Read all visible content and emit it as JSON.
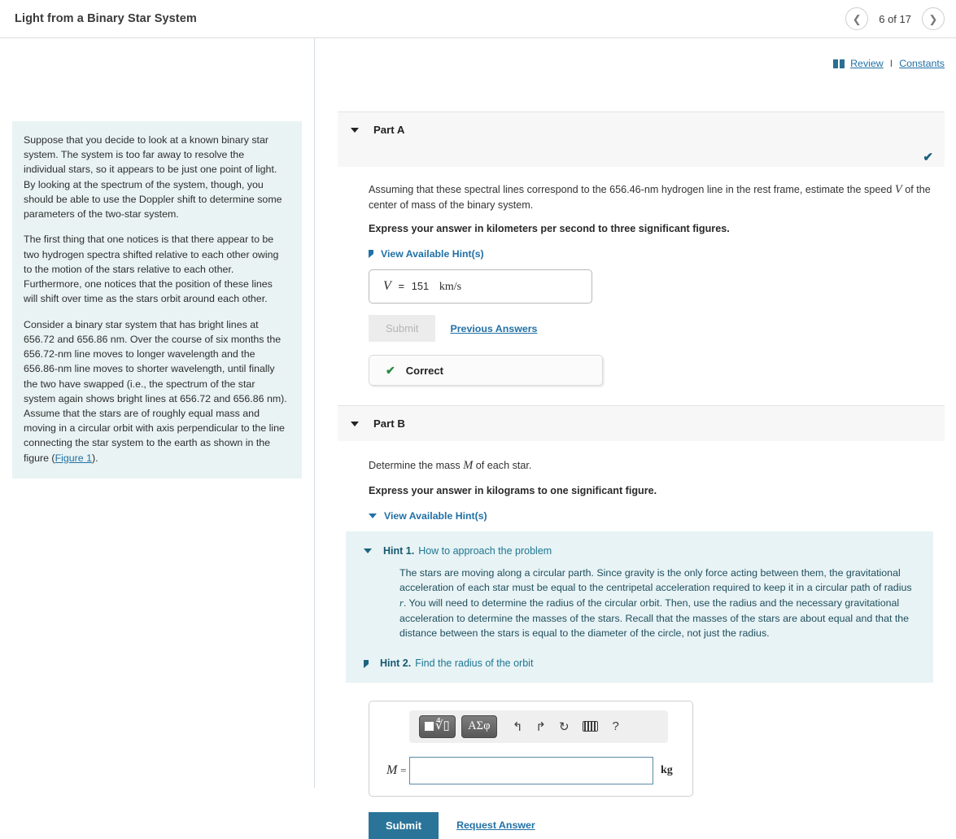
{
  "topbar": {
    "title": "Light from a Binary Star System",
    "prev_icon": "chevron-left-icon",
    "next_icon": "chevron-right-icon",
    "page_label": "6 of 17"
  },
  "tools": {
    "book_icon": "book-icon",
    "review": "Review",
    "separator": "I",
    "constants": "Constants"
  },
  "statement": {
    "paragraphs": [
      "Suppose that you decide to look at a known binary star system. The system is too far away to resolve the individual stars, so it appears to be just one point of light. By looking at the spectrum of the system, though, you should be able to use the Doppler shift to determine some parameters of the two-star system.",
      "The first thing that one notices is that there appear to be two hydrogen spectra shifted relative to each other owing to the motion of the stars relative to each other. Furthermore, one notices that the position of these lines will shift over time as the stars orbit around each other."
    ],
    "final_paragraph_before_link": "Consider a binary star system that has bright lines at 656.72 and 656.86 nm. Over the course of six months the 656.72-nm line moves to longer wavelength and the 656.86-nm line moves to shorter wavelength, until finally the two have swapped (i.e., the spectrum of the star system again shows bright lines at 656.72 and 656.86 nm). Assume that the stars are of roughly equal mass and moving in a circular orbit with axis perpendicular to the line connecting the star system to the earth as shown in the figure (",
    "figure_link": "Figure 1",
    "final_paragraph_after_link": ")."
  },
  "part_a": {
    "title": "Part A",
    "caret_icon": "caret-down-icon",
    "status_icon": "check-icon",
    "question_before_var": "Assuming that these spectral lines correspond to the 656.46-nm hydrogen line in the rest frame, estimate the speed ",
    "question_var": "V",
    "question_after_var": " of the center of mass of the binary system.",
    "instruction": "Express your answer in kilometers per second to three significant figures.",
    "hints_toggle": "View Available Hint(s)",
    "hints_toggle_icon": "caret-right-icon",
    "answer_var": "V",
    "answer_equals": "=",
    "answer_value": "151",
    "answer_unit": "km/s",
    "submit_label": "Submit",
    "previous_answers_label": "Previous Answers",
    "result_icon": "check-icon",
    "result_label": "Correct"
  },
  "part_b": {
    "title": "Part B",
    "caret_icon": "caret-down-icon",
    "question_before_var": "Determine the mass ",
    "question_var": "M",
    "question_after_var": " of each star.",
    "instruction": "Express your answer in kilograms to one significant figure.",
    "hints_toggle": "View Available Hint(s)",
    "hints_toggle_icon": "caret-down-icon",
    "hints": [
      {
        "caret_icon": "caret-down-icon",
        "number": "Hint 1.",
        "name": "How to approach the problem",
        "body_part1": "The stars are moving along a circular parth. Since gravity is the only force acting between them, the gravitational acceleration of each star must be equal to the centripetal acceleration required to keep it in a circular path of radius ",
        "body_var": "r",
        "body_part2": ". You will need to determine the radius of the circular orbit. Then, use the radius and the necessary gravitational acceleration to determine the masses of the stars. Recall that the masses of the stars are about equal and that the distance between the stars is equal to the diameter of the circle, not just the radius."
      },
      {
        "caret_icon": "caret-right-icon",
        "number": "Hint 2.",
        "name": "Find the radius of the orbit"
      }
    ],
    "toolbar": {
      "template_button": "template-button",
      "template_square": "square-glyph",
      "template_root": "∜▯",
      "greek_button": "ΑΣφ",
      "undo_icon": "undo-arrow-icon",
      "undo_glyph": "↰",
      "redo_icon": "redo-arrow-icon",
      "redo_glyph": "↱",
      "reset_icon": "reset-circle-icon",
      "reset_glyph": "↻",
      "keyboard_icon": "keyboard-icon",
      "help_icon": "question-mark-icon",
      "help_glyph": "?"
    },
    "entry_var": "M",
    "entry_equals": "=",
    "entry_value": "",
    "entry_placeholder": "",
    "entry_unit": "kg",
    "submit_label": "Submit",
    "request_answer_label": "Request Answer"
  },
  "colors": {
    "accent_link": "#2171a6",
    "submit_button": "#2b7499",
    "statement_bg": "#e9f3f3",
    "hints_bg": "#e8f3f5",
    "correct_check": "#2a8a3e",
    "status_check": "#1b5f7e"
  }
}
